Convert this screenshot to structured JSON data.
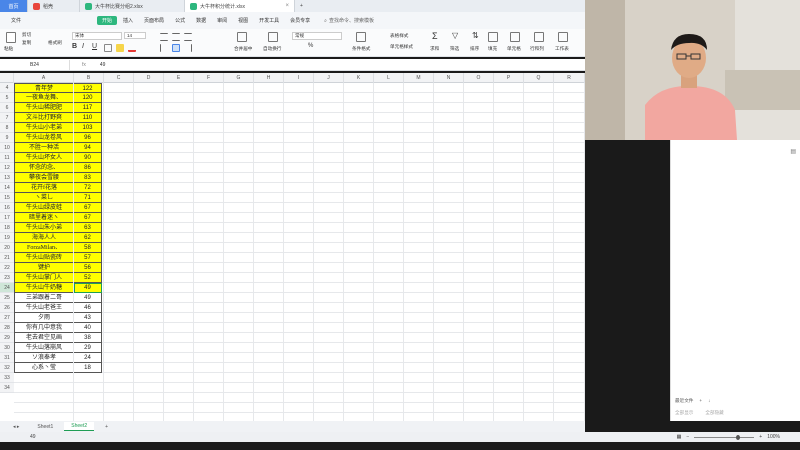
{
  "titlebar": {
    "home_tab": "首页",
    "tabs": [
      {
        "label": "稻壳",
        "color": "#e8453c"
      },
      {
        "label": "大牛杯比赛分组2.xlsx",
        "color": "#2db77e"
      },
      {
        "label": "大牛杯积分统计.xlsx",
        "color": "#2db77e",
        "active": true
      }
    ],
    "new_tab": "+"
  },
  "menu": {
    "file": "文件",
    "tabs": [
      "开始",
      "插入",
      "页面布局",
      "公式",
      "数据",
      "审阅",
      "视图",
      "开发工具",
      "会员专享"
    ],
    "active_tab": "开始",
    "search_label": "查找命令、搜索模板"
  },
  "ribbon": {
    "paste": "粘贴",
    "cut": "剪切",
    "copy": "复制",
    "format_painter": "格式刷",
    "font_name": "宋体",
    "font_size": "14",
    "bold": "B",
    "italic": "I",
    "underline": "U",
    "merge": "合并居中",
    "wrap": "自动换行",
    "number_format": "常规",
    "percent": "%",
    "cond_format": "条件格式",
    "table_style": "表格样式",
    "cell_style": "单元格样式",
    "sum": "求和",
    "filter": "筛选",
    "sort": "排序",
    "fill": "填充",
    "cells": "单元格",
    "rowcol": "行和列",
    "worksheet": "工作表"
  },
  "formula_bar": {
    "name_box": "B24",
    "fx": "fx",
    "value": "49"
  },
  "columns": [
    "A",
    "B",
    "C",
    "D",
    "E",
    "F",
    "G",
    "H",
    "I",
    "J",
    "K",
    "L",
    "M",
    "N",
    "O",
    "P",
    "Q",
    "R"
  ],
  "rows": [
    {
      "num": "4",
      "name": "青年梦",
      "value": "122",
      "hl": true
    },
    {
      "num": "5",
      "name": "一夜鱼龙舞、",
      "value": "120",
      "hl": true
    },
    {
      "num": "6",
      "name": "牛头山稀肥肥",
      "value": "117",
      "hl": true
    },
    {
      "num": "7",
      "name": "文斗比打野爽",
      "value": "110",
      "hl": true
    },
    {
      "num": "8",
      "name": "牛头山小老弟",
      "value": "103",
      "hl": true
    },
    {
      "num": "9",
      "name": "牛头山龙卷风",
      "value": "96",
      "hl": true
    },
    {
      "num": "10",
      "name": "不胜一种活",
      "value": "94",
      "hl": true
    },
    {
      "num": "11",
      "name": "牛头山坏女人",
      "value": "90",
      "hl": true
    },
    {
      "num": "12",
      "name": "怀念的念、",
      "value": "86",
      "hl": true
    },
    {
      "num": "13",
      "name": "攀夜会雪腰",
      "value": "83",
      "hl": true
    },
    {
      "num": "14",
      "name": "花开f花落",
      "value": "72",
      "hl": true
    },
    {
      "num": "15",
      "name": "ヽ菜乚",
      "value": "71",
      "hl": true
    },
    {
      "num": "16",
      "name": "牛头山绿皮蛙",
      "value": "67",
      "hl": true
    },
    {
      "num": "17",
      "name": "暗里着迷ヽ",
      "value": "67",
      "hl": true
    },
    {
      "num": "18",
      "name": "牛头山朱小弟",
      "value": "63",
      "hl": true
    },
    {
      "num": "19",
      "name": "海海人人",
      "value": "62",
      "hl": true
    },
    {
      "num": "20",
      "name": "ForzaMilan、",
      "value": "58",
      "hl": true
    },
    {
      "num": "21",
      "name": "牛头山贴瓷砖",
      "value": "57",
      "hl": true
    },
    {
      "num": "22",
      "name": "键护",
      "value": "56",
      "hl": true
    },
    {
      "num": "23",
      "name": "牛头山掌门人",
      "value": "52",
      "hl": true
    },
    {
      "num": "24",
      "name": "牛头山牛奶糖",
      "value": "49",
      "hl": true,
      "selected": true
    },
    {
      "num": "25",
      "name": "三弟跟着二哥",
      "value": "49",
      "hl": false
    },
    {
      "num": "26",
      "name": "牛头山老爸王",
      "value": "46",
      "hl": false
    },
    {
      "num": "27",
      "name": "夕雨",
      "value": "43",
      "hl": false
    },
    {
      "num": "28",
      "name": "你有几中意我",
      "value": "40",
      "hl": false
    },
    {
      "num": "29",
      "name": "老去君空见画",
      "value": "38",
      "hl": false
    },
    {
      "num": "30",
      "name": "牛头山落崩风",
      "value": "29",
      "hl": false
    },
    {
      "num": "31",
      "name": "ソ浪奉孝",
      "value": "24",
      "hl": false
    },
    {
      "num": "32",
      "name": "心系丶莹",
      "value": "18",
      "hl": false
    },
    {
      "num": "33",
      "name": "",
      "value": "",
      "hl": false,
      "empty": true
    },
    {
      "num": "34",
      "name": "",
      "value": "",
      "hl": false,
      "empty": true
    }
  ],
  "sheets": [
    "Sheet1",
    "Sheet2"
  ],
  "active_sheet": "Sheet2",
  "add_sheet": "+",
  "status": {
    "value": "49",
    "zoom": "100%"
  },
  "right_panel": {
    "label": "最近文件",
    "btn1": "全部显示",
    "btn2": "全部隐藏"
  },
  "colors": {
    "highlight": "#ffff00",
    "accent": "#2db77e"
  }
}
